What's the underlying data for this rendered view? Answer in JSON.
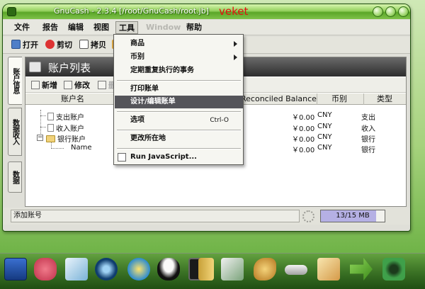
{
  "window": {
    "title": "GnuCash - 2.3.4  [/root/GnuCash/root.jb]",
    "brand": "veket"
  },
  "menu": {
    "items": [
      {
        "label": "文件",
        "state": "normal"
      },
      {
        "label": "报告",
        "state": "normal"
      },
      {
        "label": "编辑",
        "state": "normal"
      },
      {
        "label": "视图",
        "state": "normal"
      },
      {
        "label": "工具",
        "state": "active"
      },
      {
        "label": "Window",
        "state": "disabled"
      },
      {
        "label": "帮助",
        "state": "normal"
      }
    ]
  },
  "toolbar": {
    "open": "打开",
    "cut": "剪切",
    "copy": "拷贝"
  },
  "sidetabs": {
    "accounts": "账户信息",
    "income": "数据收入",
    "other": "数据"
  },
  "panel": {
    "title": "账户列表",
    "new": "新增",
    "edit": "修改",
    "delete": "删除",
    "columns": {
      "name": "账户名",
      "reconciled": "Reconciled Balance",
      "currency": "币别",
      "type": "类型"
    },
    "rows": [
      {
        "name": "支出账户",
        "balance": "￥0.00",
        "currency": "CNY",
        "type": "支出"
      },
      {
        "name": "收入账户",
        "balance": "￥0.00",
        "currency": "CNY",
        "type": "收入"
      },
      {
        "name": "银行账户",
        "balance": "￥0.00",
        "currency": "CNY",
        "type": "银行"
      },
      {
        "name": "Name",
        "balance": "￥0.00",
        "currency": "CNY",
        "type": "银行"
      }
    ]
  },
  "status": {
    "text": "添加账号",
    "memory": "13/15 MB",
    "memory_fraction": 0.87
  },
  "dropdown": {
    "items": {
      "goods": "商品",
      "currency": "币别",
      "scheduled": "定期重复执行的事务",
      "print_check": "打印账单",
      "design_check": "设计/编辑账单",
      "options": "选项",
      "options_shortcut": "Ctrl-O",
      "change_location": "更改所在地",
      "run_js": "Run JavaScript..."
    }
  },
  "dock": {
    "icons": [
      "monitor-icon",
      "pig-icon",
      "pencil-icon",
      "media-player-icon",
      "penguin-ball-icon",
      "qq-penguin-icon",
      "terminal-icon",
      "notebook-icon",
      "photo-app-icon",
      "paint-palette-icon",
      "usb-drive-icon",
      "image-viewer-icon",
      "arrow-app-icon",
      "camera-icon"
    ]
  }
}
